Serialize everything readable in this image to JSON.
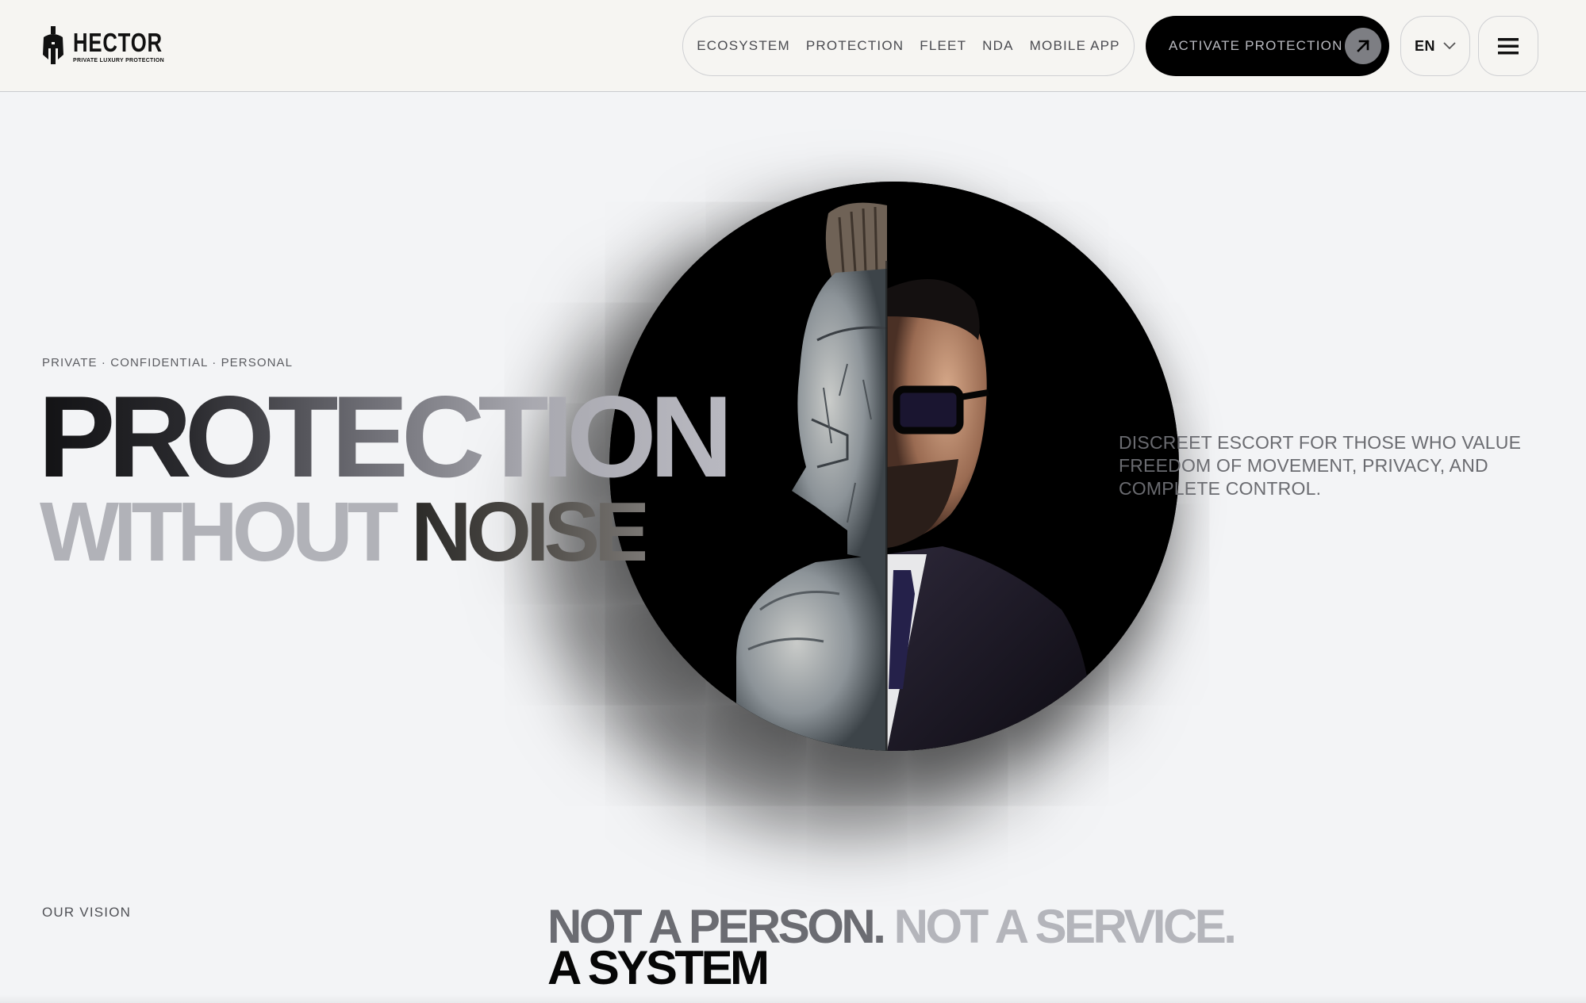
{
  "brand": {
    "name": "HECTOR",
    "tagline": "PRIVATE LUXURY PROTECTION"
  },
  "nav": {
    "items": [
      {
        "label": "ECOSYSTEM"
      },
      {
        "label": "PROTECTION"
      },
      {
        "label": "FLEET"
      },
      {
        "label": "NDA"
      },
      {
        "label": "MOBILE APP"
      }
    ]
  },
  "cta": {
    "label": "ACTIVATE PROTECTION",
    "icon": "arrow-up-right-icon"
  },
  "language": {
    "selected": "EN",
    "icon": "chevron-down-icon"
  },
  "menu": {
    "icon": "hamburger-menu-icon"
  },
  "hero": {
    "eyebrow": "PRIVATE · CONFIDENTIAL · PERSONAL",
    "headline_line1": "PROTECTION",
    "headline_line2_light": "WITHOUT",
    "headline_line2_dark": "NOISE",
    "description": "DISCREET ESCORT FOR THOSE WHO VALUE FREEDOM OF MOVEMENT, PRIVACY, AND COMPLETE CONTROL.",
    "image_subject": "half-spartan-helmet-half-businessman-portrait"
  },
  "vision": {
    "label": "OUR VISION",
    "line1_part1": "NOT A PERSON.",
    "line1_part2": "NOT A SERVICE.",
    "line2": "A SYSTEM"
  },
  "colors": {
    "background": "#f3f4f6",
    "header_background": "#f6f5f2",
    "cta_background": "#000000",
    "text_dark": "#111111",
    "text_muted": "#6a6b70",
    "text_light": "#b1b2b8"
  }
}
